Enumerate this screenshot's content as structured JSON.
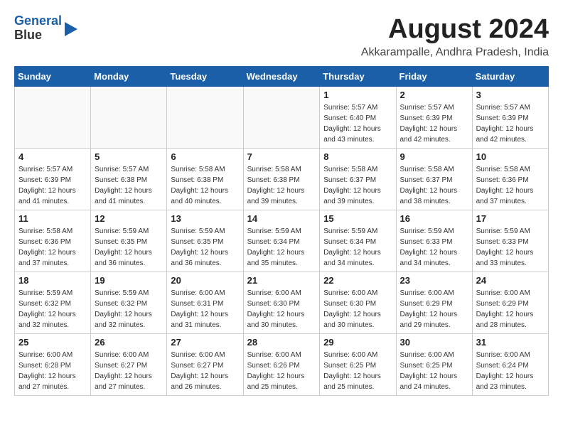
{
  "header": {
    "logo_line1": "General",
    "logo_line2": "Blue",
    "month_title": "August 2024",
    "location": "Akkarampalle, Andhra Pradesh, India"
  },
  "weekdays": [
    "Sunday",
    "Monday",
    "Tuesday",
    "Wednesday",
    "Thursday",
    "Friday",
    "Saturday"
  ],
  "weeks": [
    [
      {
        "day": "",
        "info": ""
      },
      {
        "day": "",
        "info": ""
      },
      {
        "day": "",
        "info": ""
      },
      {
        "day": "",
        "info": ""
      },
      {
        "day": "1",
        "info": "Sunrise: 5:57 AM\nSunset: 6:40 PM\nDaylight: 12 hours\nand 43 minutes."
      },
      {
        "day": "2",
        "info": "Sunrise: 5:57 AM\nSunset: 6:39 PM\nDaylight: 12 hours\nand 42 minutes."
      },
      {
        "day": "3",
        "info": "Sunrise: 5:57 AM\nSunset: 6:39 PM\nDaylight: 12 hours\nand 42 minutes."
      }
    ],
    [
      {
        "day": "4",
        "info": "Sunrise: 5:57 AM\nSunset: 6:39 PM\nDaylight: 12 hours\nand 41 minutes."
      },
      {
        "day": "5",
        "info": "Sunrise: 5:57 AM\nSunset: 6:38 PM\nDaylight: 12 hours\nand 41 minutes."
      },
      {
        "day": "6",
        "info": "Sunrise: 5:58 AM\nSunset: 6:38 PM\nDaylight: 12 hours\nand 40 minutes."
      },
      {
        "day": "7",
        "info": "Sunrise: 5:58 AM\nSunset: 6:38 PM\nDaylight: 12 hours\nand 39 minutes."
      },
      {
        "day": "8",
        "info": "Sunrise: 5:58 AM\nSunset: 6:37 PM\nDaylight: 12 hours\nand 39 minutes."
      },
      {
        "day": "9",
        "info": "Sunrise: 5:58 AM\nSunset: 6:37 PM\nDaylight: 12 hours\nand 38 minutes."
      },
      {
        "day": "10",
        "info": "Sunrise: 5:58 AM\nSunset: 6:36 PM\nDaylight: 12 hours\nand 37 minutes."
      }
    ],
    [
      {
        "day": "11",
        "info": "Sunrise: 5:58 AM\nSunset: 6:36 PM\nDaylight: 12 hours\nand 37 minutes."
      },
      {
        "day": "12",
        "info": "Sunrise: 5:59 AM\nSunset: 6:35 PM\nDaylight: 12 hours\nand 36 minutes."
      },
      {
        "day": "13",
        "info": "Sunrise: 5:59 AM\nSunset: 6:35 PM\nDaylight: 12 hours\nand 36 minutes."
      },
      {
        "day": "14",
        "info": "Sunrise: 5:59 AM\nSunset: 6:34 PM\nDaylight: 12 hours\nand 35 minutes."
      },
      {
        "day": "15",
        "info": "Sunrise: 5:59 AM\nSunset: 6:34 PM\nDaylight: 12 hours\nand 34 minutes."
      },
      {
        "day": "16",
        "info": "Sunrise: 5:59 AM\nSunset: 6:33 PM\nDaylight: 12 hours\nand 34 minutes."
      },
      {
        "day": "17",
        "info": "Sunrise: 5:59 AM\nSunset: 6:33 PM\nDaylight: 12 hours\nand 33 minutes."
      }
    ],
    [
      {
        "day": "18",
        "info": "Sunrise: 5:59 AM\nSunset: 6:32 PM\nDaylight: 12 hours\nand 32 minutes."
      },
      {
        "day": "19",
        "info": "Sunrise: 5:59 AM\nSunset: 6:32 PM\nDaylight: 12 hours\nand 32 minutes."
      },
      {
        "day": "20",
        "info": "Sunrise: 6:00 AM\nSunset: 6:31 PM\nDaylight: 12 hours\nand 31 minutes."
      },
      {
        "day": "21",
        "info": "Sunrise: 6:00 AM\nSunset: 6:30 PM\nDaylight: 12 hours\nand 30 minutes."
      },
      {
        "day": "22",
        "info": "Sunrise: 6:00 AM\nSunset: 6:30 PM\nDaylight: 12 hours\nand 30 minutes."
      },
      {
        "day": "23",
        "info": "Sunrise: 6:00 AM\nSunset: 6:29 PM\nDaylight: 12 hours\nand 29 minutes."
      },
      {
        "day": "24",
        "info": "Sunrise: 6:00 AM\nSunset: 6:29 PM\nDaylight: 12 hours\nand 28 minutes."
      }
    ],
    [
      {
        "day": "25",
        "info": "Sunrise: 6:00 AM\nSunset: 6:28 PM\nDaylight: 12 hours\nand 27 minutes."
      },
      {
        "day": "26",
        "info": "Sunrise: 6:00 AM\nSunset: 6:27 PM\nDaylight: 12 hours\nand 27 minutes."
      },
      {
        "day": "27",
        "info": "Sunrise: 6:00 AM\nSunset: 6:27 PM\nDaylight: 12 hours\nand 26 minutes."
      },
      {
        "day": "28",
        "info": "Sunrise: 6:00 AM\nSunset: 6:26 PM\nDaylight: 12 hours\nand 25 minutes."
      },
      {
        "day": "29",
        "info": "Sunrise: 6:00 AM\nSunset: 6:25 PM\nDaylight: 12 hours\nand 25 minutes."
      },
      {
        "day": "30",
        "info": "Sunrise: 6:00 AM\nSunset: 6:25 PM\nDaylight: 12 hours\nand 24 minutes."
      },
      {
        "day": "31",
        "info": "Sunrise: 6:00 AM\nSunset: 6:24 PM\nDaylight: 12 hours\nand 23 minutes."
      }
    ]
  ]
}
